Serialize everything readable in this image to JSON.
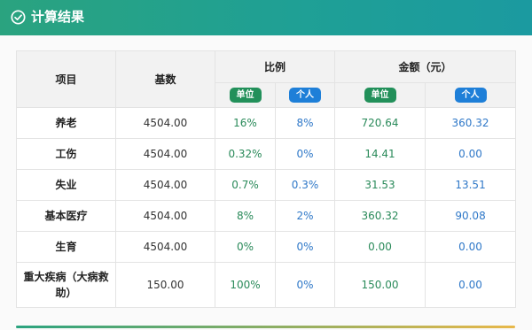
{
  "header": {
    "title": "计算结果",
    "icon": "check-circle-icon"
  },
  "table": {
    "headers": {
      "item": "项目",
      "base": "基数",
      "ratio": "比例",
      "amount": "金额（元）",
      "unit": "单位",
      "personal": "个人"
    },
    "rows": [
      {
        "name": "养老",
        "base": "4504.00",
        "ratio_unit": "16%",
        "ratio_personal": "8%",
        "amount_unit": "720.64",
        "amount_personal": "360.32"
      },
      {
        "name": "工伤",
        "base": "4504.00",
        "ratio_unit": "0.32%",
        "ratio_personal": "0%",
        "amount_unit": "14.41",
        "amount_personal": "0.00"
      },
      {
        "name": "失业",
        "base": "4504.00",
        "ratio_unit": "0.7%",
        "ratio_personal": "0.3%",
        "amount_unit": "31.53",
        "amount_personal": "13.51"
      },
      {
        "name": "基本医疗",
        "base": "4504.00",
        "ratio_unit": "8%",
        "ratio_personal": "2%",
        "amount_unit": "360.32",
        "amount_personal": "90.08"
      },
      {
        "name": "生育",
        "base": "4504.00",
        "ratio_unit": "0%",
        "ratio_personal": "0%",
        "amount_unit": "0.00",
        "amount_personal": "0.00"
      },
      {
        "name": "重大疾病（大病救助）",
        "base": "150.00",
        "ratio_unit": "100%",
        "ratio_personal": "0%",
        "amount_unit": "150.00",
        "amount_personal": "0.00"
      }
    ]
  },
  "colors": {
    "header_start": "#2aa37f",
    "header_end": "#1b9aa0",
    "unit_green": "#22905a",
    "personal_blue": "#1e7fd8"
  }
}
